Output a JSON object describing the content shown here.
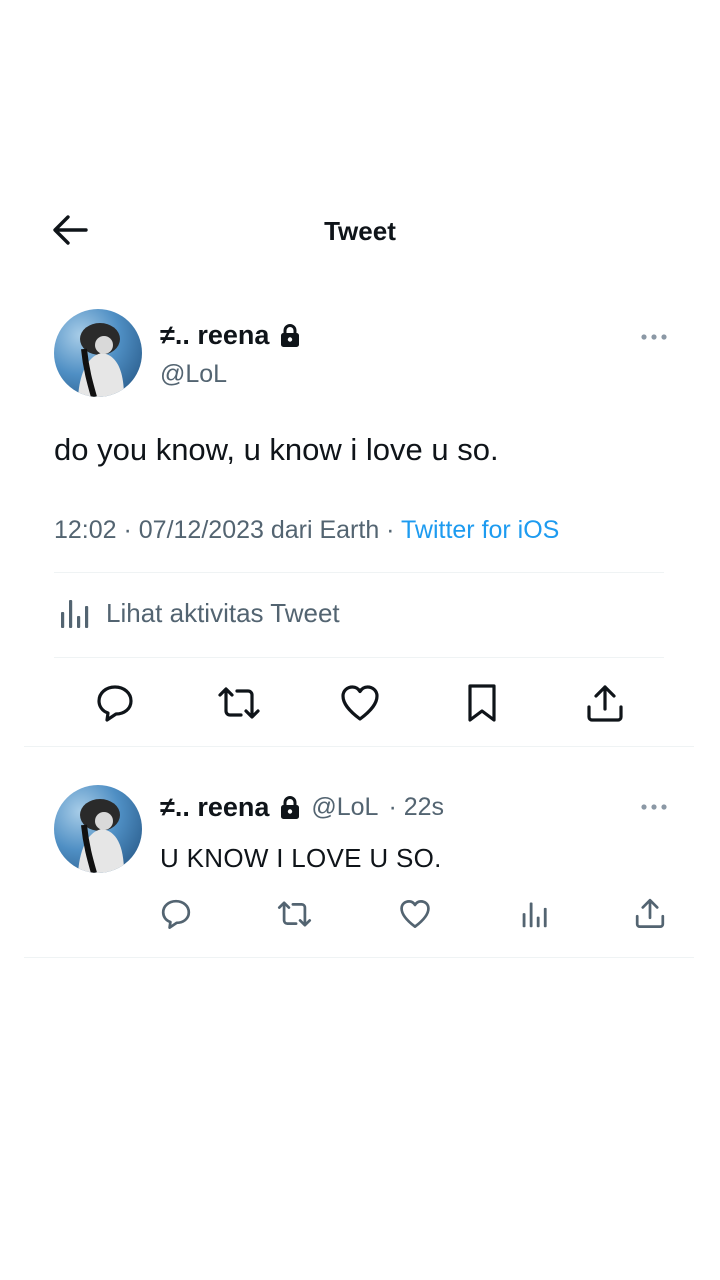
{
  "header": {
    "title": "Tweet",
    "back_icon": "arrow-left-icon"
  },
  "main_tweet": {
    "display_name": "≠.. reena",
    "handle": "@LoL",
    "protected_icon": "lock-icon",
    "text": "do you know, u know i love u so.",
    "timestamp": "12:02 · 07/12/2023 dari Earth",
    "separator": " · ",
    "source": "Twitter for iOS",
    "activity_label": "Lihat aktivitas Tweet",
    "actions": [
      "reply-icon",
      "retweet-icon",
      "like-icon",
      "bookmark-icon",
      "share-icon"
    ]
  },
  "reply": {
    "display_name": "≠.. reena",
    "handle": "@LoL",
    "time": "· 22s",
    "text": "U KNOW I LOVE U SO.",
    "actions": [
      "reply-icon",
      "retweet-icon",
      "like-icon",
      "analytics-icon",
      "share-icon"
    ]
  },
  "colors": {
    "text_primary": "#0f1419",
    "text_secondary": "#536471",
    "link": "#1d9bf0",
    "divider": "#eff3f4"
  }
}
